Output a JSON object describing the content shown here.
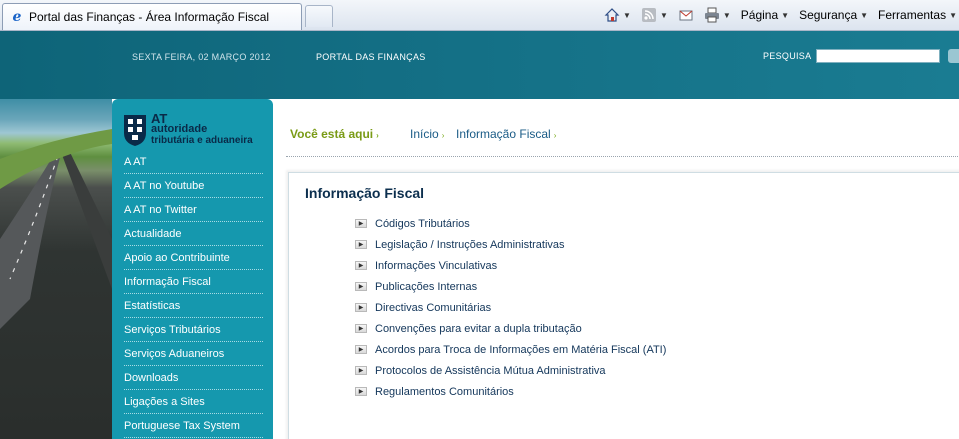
{
  "browser": {
    "tab_title": "Portal das Finanças - Área Informação Fiscal",
    "commands": [
      "Página",
      "Segurança",
      "Ferramentas"
    ],
    "icons": [
      "ie-icon",
      "home-icon",
      "rss-icon",
      "mail-icon",
      "print-icon"
    ]
  },
  "header": {
    "date": "SEXTA FEIRA, 02 MARÇO 2012",
    "portal": "PORTAL DAS FINANÇAS",
    "search_label": "PESQUISA",
    "search_value": ""
  },
  "logo": {
    "abbr": "AT",
    "line1": "autoridade",
    "line2": "tributária e aduaneira"
  },
  "sidebar": {
    "items": [
      {
        "label": "A AT"
      },
      {
        "label": "A AT no Youtube"
      },
      {
        "label": "A AT no Twitter"
      },
      {
        "label": "Actualidade"
      },
      {
        "label": "Apoio ao Contribuinte"
      },
      {
        "label": "Informação Fiscal"
      },
      {
        "label": "Estatísticas"
      },
      {
        "label": "Serviços Tributários"
      },
      {
        "label": "Serviços Aduaneiros"
      },
      {
        "label": "Downloads"
      },
      {
        "label": "Ligações a Sites"
      },
      {
        "label": "Portuguese Tax System"
      }
    ]
  },
  "breadcrumb": {
    "here": "Você está aqui",
    "home": "Início",
    "current": "Informação Fiscal",
    "separator": "›"
  },
  "main": {
    "title": "Informação Fiscal",
    "links": [
      {
        "label": "Códigos Tributários"
      },
      {
        "label": "Legislação / Instruções Administrativas"
      },
      {
        "label": "Informações Vinculativas"
      },
      {
        "label": "Publicações Internas"
      },
      {
        "label": "Directivas Comunitárias"
      },
      {
        "label": "Convenções para evitar a dupla tributação"
      },
      {
        "label": "Acordos para Troca de Informações em Matéria Fiscal (ATI)"
      },
      {
        "label": "Protocolos de Assistência Mútua Administrativa"
      },
      {
        "label": "Regulamentos Comunitários"
      }
    ]
  },
  "colors": {
    "header": "#136e84",
    "sidebar": "#1598ae",
    "breadcrumb_here": "#7a9b16",
    "title": "#0c2f4e"
  }
}
